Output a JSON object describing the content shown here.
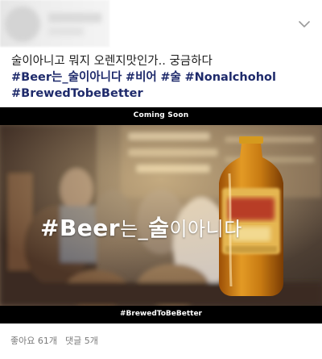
{
  "post": {
    "caption_line1": "술이아니고 뭐지 오렌지맛인가.. 궁금하다",
    "hashtags_line2": [
      "#Beer는_술이아니다",
      "#비어",
      "#술",
      "#Nonalchohol"
    ],
    "hashtags_line3": [
      "#BrewedTobeBetter"
    ]
  },
  "video": {
    "top_caption": "Coming Soon",
    "overlay_hashtag": "#Beer",
    "overlay_small": "는_",
    "overlay_word": "술",
    "overlay_tail": "이아니다",
    "bottom_caption": "#BrewedToBeBetter"
  },
  "stats": {
    "likes": "좋아요 61개",
    "comments": "댓글 5개"
  },
  "icons": {
    "menu": "chevron-down-icon"
  }
}
